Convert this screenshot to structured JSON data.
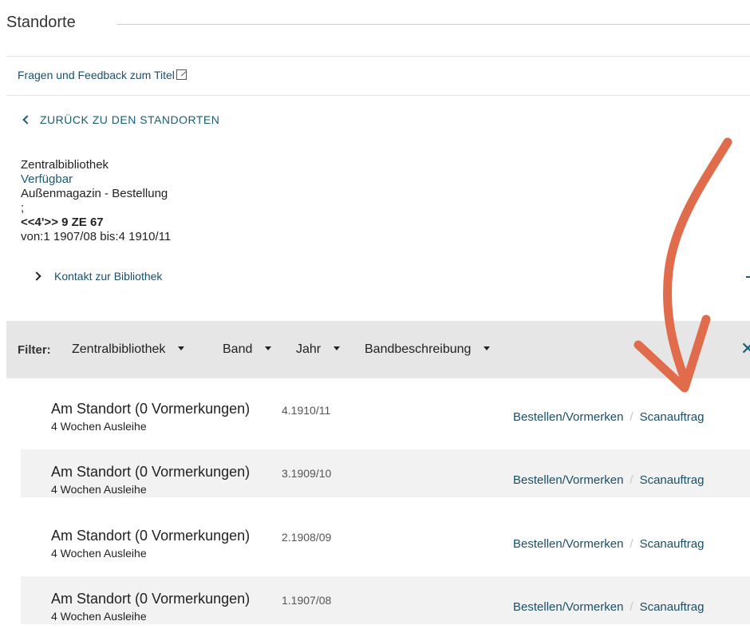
{
  "section": {
    "title": "Standorte"
  },
  "feedback": {
    "label": "Fragen und Feedback zum Titel"
  },
  "back": {
    "label": "ZURÜCK ZU DEN STANDORTEN"
  },
  "library": {
    "name": "Zentralbibliothek",
    "status": "Verfügbar",
    "location": "Außenmagazin - Bestellung",
    "separator": ";",
    "signature": "<<4'>> 9 ZE 67",
    "range": "von:1 1907/08 bis:4 1910/11",
    "contact": "Kontakt zur Bibliothek"
  },
  "filter": {
    "label": "Filter:",
    "options": [
      "Zentralbibliothek",
      "Band",
      "Jahr",
      "Bandbeschreibung"
    ],
    "close": "✕"
  },
  "items": [
    {
      "status": "Am Standort (0 Vormerkungen)",
      "volume": "4.1910/11",
      "loan": "4 Wochen Ausleihe",
      "order": "Bestellen/Vormerken",
      "scan": "Scanauftrag"
    },
    {
      "status": "Am Standort (0 Vormerkungen)",
      "volume": "3.1909/10",
      "loan": "4 Wochen Ausleihe",
      "order": "Bestellen/Vormerken",
      "scan": "Scanauftrag"
    },
    {
      "status": "Am Standort (0 Vormerkungen)",
      "volume": "2.1908/09",
      "loan": "4 Wochen Ausleihe",
      "order": "Bestellen/Vormerken",
      "scan": "Scanauftrag"
    },
    {
      "status": "Am Standort (0 Vormerkungen)",
      "volume": "1.1907/08",
      "loan": "4 Wochen Ausleihe",
      "order": "Bestellen/Vormerken",
      "scan": "Scanauftrag"
    }
  ],
  "colors": {
    "link": "#1a4f66",
    "accent": "#1a5d73",
    "annotation_arrow": "#e06c4c",
    "filter_bg": "#e6e6e6"
  },
  "icons": {
    "external": "external-link-icon",
    "back": "chevron-left-icon",
    "contact": "chevron-right-icon",
    "caret": "caret-down-icon",
    "close": "close-icon"
  }
}
